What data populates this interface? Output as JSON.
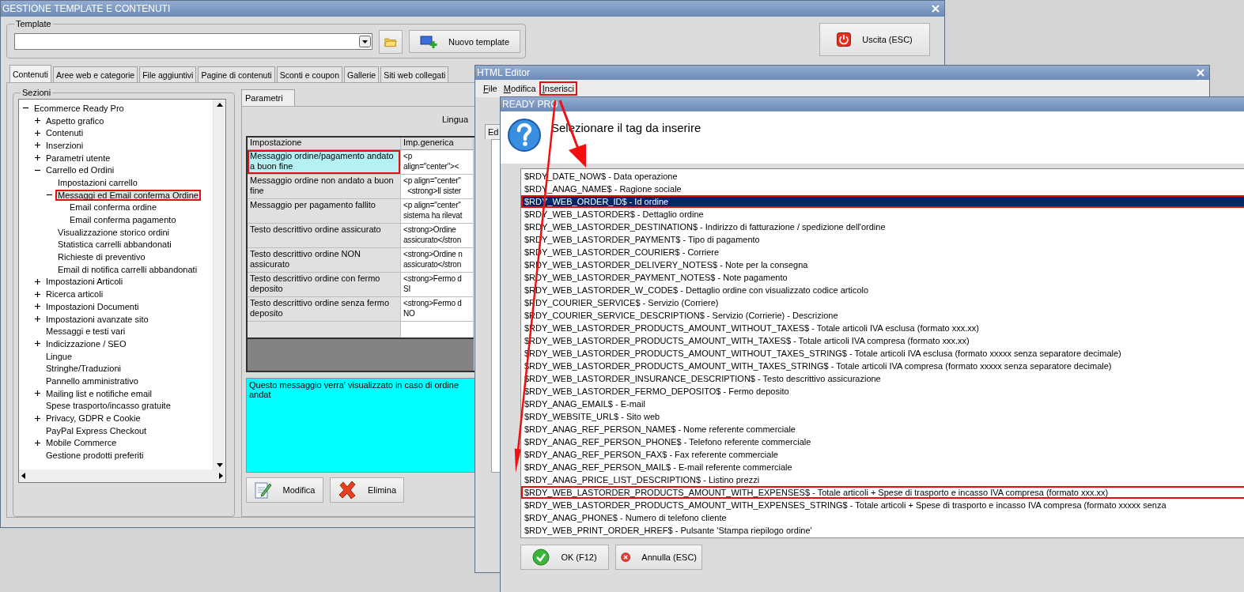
{
  "main_window": {
    "title": "GESTIONE TEMPLATE E CONTENUTI",
    "template": {
      "legend": "Template"
    },
    "new_template_button": "Nuovo template",
    "exit_button": "Uscita (ESC)",
    "tabs": [
      {
        "label": "Contenuti",
        "selected": true
      },
      {
        "label": "Aree web e categorie",
        "selected": false
      },
      {
        "label": "File aggiuntivi",
        "selected": false
      },
      {
        "label": "Pagine di contenuti",
        "selected": false
      },
      {
        "label": "Sconti e coupon",
        "selected": false
      },
      {
        "label": "Gallerie",
        "selected": false
      },
      {
        "label": "Siti web collegati",
        "selected": false
      }
    ],
    "sections": {
      "legend": "Sezioni",
      "tree": [
        {
          "label": "Ecommerce Ready Pro",
          "expanded": true,
          "selected": false,
          "highlighted": false,
          "children": [
            {
              "label": "Aspetto grafico",
              "expanded": false,
              "selected": false,
              "highlighted": false
            },
            {
              "label": "Contenuti",
              "expanded": false,
              "selected": false,
              "highlighted": false
            },
            {
              "label": "Inserzioni",
              "expanded": false,
              "selected": false,
              "highlighted": false
            },
            {
              "label": "Parametri utente",
              "expanded": false,
              "selected": false,
              "highlighted": false
            },
            {
              "label": "Carrello ed Ordini",
              "expanded": true,
              "selected": false,
              "highlighted": false,
              "children": [
                {
                  "label": "Impostazioni carrello",
                  "selected": false,
                  "highlighted": false
                },
                {
                  "label": "Messaggi ed Email conferma Ordine",
                  "expanded": true,
                  "selected": true,
                  "highlighted": true,
                  "children": [
                    {
                      "label": "Email conferma ordine",
                      "selected": false,
                      "highlighted": false
                    },
                    {
                      "label": "Email conferma pagamento",
                      "selected": false,
                      "highlighted": false
                    }
                  ]
                },
                {
                  "label": "Visualizzazione storico ordini",
                  "selected": false,
                  "highlighted": false
                },
                {
                  "label": "Statistica carrelli abbandonati",
                  "selected": false,
                  "highlighted": false
                },
                {
                  "label": "Richieste di preventivo",
                  "selected": false,
                  "highlighted": false
                },
                {
                  "label": "Email di notifica carrelli abbandonati",
                  "selected": false,
                  "highlighted": false
                }
              ]
            },
            {
              "label": "Impostazioni Articoli",
              "expanded": false,
              "selected": false,
              "highlighted": false
            },
            {
              "label": "Ricerca articoli",
              "expanded": false,
              "selected": false,
              "highlighted": false
            },
            {
              "label": "Impostazioni Documenti",
              "expanded": false,
              "selected": false,
              "highlighted": false
            },
            {
              "label": "Impostazioni avanzate sito",
              "expanded": false,
              "selected": false,
              "highlighted": false
            },
            {
              "label": "Messaggi e testi vari",
              "selected": false,
              "highlighted": false
            },
            {
              "label": "Indicizzazione / SEO",
              "expanded": false,
              "selected": false,
              "highlighted": false
            },
            {
              "label": "Lingue",
              "selected": false,
              "highlighted": false
            },
            {
              "label": "Stringhe/Traduzioni",
              "selected": false,
              "highlighted": false
            },
            {
              "label": "Pannello amministrativo",
              "selected": false,
              "highlighted": false
            },
            {
              "label": "Mailing list e notifiche email",
              "expanded": false,
              "selected": false,
              "highlighted": false
            },
            {
              "label": "Spese trasporto/incasso gratuite",
              "selected": false,
              "highlighted": false
            },
            {
              "label": "Privacy, GDPR e Cookie",
              "expanded": false,
              "selected": false,
              "highlighted": false
            },
            {
              "label": "PayPal Express Checkout",
              "selected": false,
              "highlighted": false
            },
            {
              "label": "Mobile Commerce",
              "expanded": false,
              "selected": false,
              "highlighted": false
            },
            {
              "label": "Gestione prodotti preferiti",
              "selected": false,
              "highlighted": false
            }
          ]
        }
      ]
    },
    "parameters": {
      "tab": "Parametri",
      "language_label": "Lingua",
      "columns": [
        "Impostazione",
        "Imp.generica"
      ],
      "rows": [
        {
          "setting": "Messaggio ordine/pagamento andato a buon fine",
          "generic": "<p\nalign=\"center\"><",
          "selected": true,
          "highlighted": true
        },
        {
          "setting": "Messaggio ordine non andato a buon fine",
          "generic": "<p align=\"center\"\n  <strong>Il sister",
          "selected": false,
          "highlighted": false
        },
        {
          "setting": "Messaggio per pagamento fallito",
          "generic": "<p align=\"center\"\nsistema ha rilevat",
          "selected": false,
          "highlighted": false
        },
        {
          "setting": "Testo descrittivo ordine assicurato",
          "generic": "<strong>Ordine\nassicurato</stron",
          "selected": false,
          "highlighted": false
        },
        {
          "setting": "Testo descrittivo ordine NON assicurato",
          "generic": "<strong>Ordine n\nassicurato</stron",
          "selected": false,
          "highlighted": false
        },
        {
          "setting": "Testo descrittivo ordine con fermo deposito",
          "generic": "<strong>Fermo d\nSI",
          "selected": false,
          "highlighted": false
        },
        {
          "setting": "Testo descrittivo ordine senza fermo deposito",
          "generic": "<strong>Fermo d\nNO",
          "selected": false,
          "highlighted": false
        }
      ],
      "description": "Questo messaggio verra' visualizzato in caso di ordine andat",
      "buttons": [
        {
          "label": "Modifica",
          "kind": "edit"
        },
        {
          "label": "Elimina",
          "kind": "delete"
        }
      ]
    }
  },
  "html_editor": {
    "title": "HTML Editor",
    "menu": [
      {
        "label": "File",
        "highlighted": false
      },
      {
        "label": "Modifica",
        "highlighted": false
      },
      {
        "label": "Inserisci",
        "highlighted": true
      }
    ],
    "tab": "Ed"
  },
  "tag_dialog": {
    "title": "READY PRO",
    "prompt": "Selezionare il tag da inserire",
    "tags": [
      {
        "label": "$RDY_DATE_NOW$ - Data operazione",
        "selected": false,
        "highlighted": false
      },
      {
        "label": "$RDY_ANAG_NAME$ - Ragione sociale",
        "selected": false,
        "highlighted": false
      },
      {
        "label": "$RDY_WEB_ORDER_ID$ - Id ordine",
        "selected": true,
        "highlighted": true
      },
      {
        "label": "$RDY_WEB_LASTORDER$ - Dettaglio ordine",
        "selected": false,
        "highlighted": false
      },
      {
        "label": "$RDY_WEB_LASTORDER_DESTINATION$ - Indirizzo di fatturazione / spedizione dell'ordine",
        "selected": false,
        "highlighted": false
      },
      {
        "label": "$RDY_WEB_LASTORDER_PAYMENT$ - Tipo di pagamento",
        "selected": false,
        "highlighted": false
      },
      {
        "label": "$RDY_WEB_LASTORDER_COURIER$ - Corriere",
        "selected": false,
        "highlighted": false
      },
      {
        "label": "$RDY_WEB_LASTORDER_DELIVERY_NOTES$ - Note per la consegna",
        "selected": false,
        "highlighted": false
      },
      {
        "label": "$RDY_WEB_LASTORDER_PAYMENT_NOTES$ - Note pagamento",
        "selected": false,
        "highlighted": false
      },
      {
        "label": "$RDY_WEB_LASTORDER_W_CODE$ - Dettaglio ordine con visualizzato codice articolo",
        "selected": false,
        "highlighted": false
      },
      {
        "label": "$RDY_COURIER_SERVICE$ - Servizio (Corriere)",
        "selected": false,
        "highlighted": false
      },
      {
        "label": "$RDY_COURIER_SERVICE_DESCRIPTION$ - Servizio (Corrierie) - Descrizione",
        "selected": false,
        "highlighted": false
      },
      {
        "label": "$RDY_WEB_LASTORDER_PRODUCTS_AMOUNT_WITHOUT_TAXES$ - Totale articoli IVA esclusa (formato xxx.xx)",
        "selected": false,
        "highlighted": false
      },
      {
        "label": "$RDY_WEB_LASTORDER_PRODUCTS_AMOUNT_WITH_TAXES$ - Totale articoli IVA compresa (formato xxx.xx)",
        "selected": false,
        "highlighted": false
      },
      {
        "label": "$RDY_WEB_LASTORDER_PRODUCTS_AMOUNT_WITHOUT_TAXES_STRING$ - Totale articoli IVA esclusa (formato xxxxx senza separatore decimale)",
        "selected": false,
        "highlighted": false
      },
      {
        "label": "$RDY_WEB_LASTORDER_PRODUCTS_AMOUNT_WITH_TAXES_STRING$ - Totale articoli IVA compresa (formato xxxxx senza separatore decimale)",
        "selected": false,
        "highlighted": false
      },
      {
        "label": "$RDY_WEB_LASTORDER_INSURANCE_DESCRIPTION$ - Testo descrittivo assicurazione",
        "selected": false,
        "highlighted": false
      },
      {
        "label": "$RDY_WEB_LASTORDER_FERMO_DEPOSITO$ - Fermo deposito",
        "selected": false,
        "highlighted": false
      },
      {
        "label": "$RDY_ANAG_EMAIL$ - E-mail",
        "selected": false,
        "highlighted": false
      },
      {
        "label": "$RDY_WEBSITE_URL$ - Sito web",
        "selected": false,
        "highlighted": false
      },
      {
        "label": "$RDY_ANAG_REF_PERSON_NAME$ - Nome referente commerciale",
        "selected": false,
        "highlighted": false
      },
      {
        "label": "$RDY_ANAG_REF_PERSON_PHONE$ - Telefono referente commerciale",
        "selected": false,
        "highlighted": false
      },
      {
        "label": "$RDY_ANAG_REF_PERSON_FAX$ - Fax referente commerciale",
        "selected": false,
        "highlighted": false
      },
      {
        "label": "$RDY_ANAG_REF_PERSON_MAIL$ - E-mail referente commerciale",
        "selected": false,
        "highlighted": false
      },
      {
        "label": "$RDY_ANAG_PRICE_LIST_DESCRIPTION$ - Listino prezzi",
        "selected": false,
        "highlighted": false
      },
      {
        "label": "$RDY_WEB_LASTORDER_PRODUCTS_AMOUNT_WITH_EXPENSES$ - Totale articoli + Spese di trasporto e incasso IVA compresa (formato xxx.xx)",
        "selected": false,
        "highlighted": true
      },
      {
        "label": "$RDY_WEB_LASTORDER_PRODUCTS_AMOUNT_WITH_EXPENSES_STRING$ - Totale articoli + Spese di trasporto e incasso IVA compresa (formato xxxxx senza",
        "selected": false,
        "highlighted": false
      },
      {
        "label": "$RDY_ANAG_PHONE$ - Numero di telefono cliente",
        "selected": false,
        "highlighted": false
      },
      {
        "label": "$RDY_WEB_PRINT_ORDER_HREF$ - Pulsante 'Stampa riepilogo ordine'",
        "selected": false,
        "highlighted": false
      }
    ],
    "buttons": [
      {
        "label": "OK (F12)",
        "kind": "ok"
      },
      {
        "label": "Annulla (ESC)",
        "kind": "cancel"
      }
    ]
  }
}
